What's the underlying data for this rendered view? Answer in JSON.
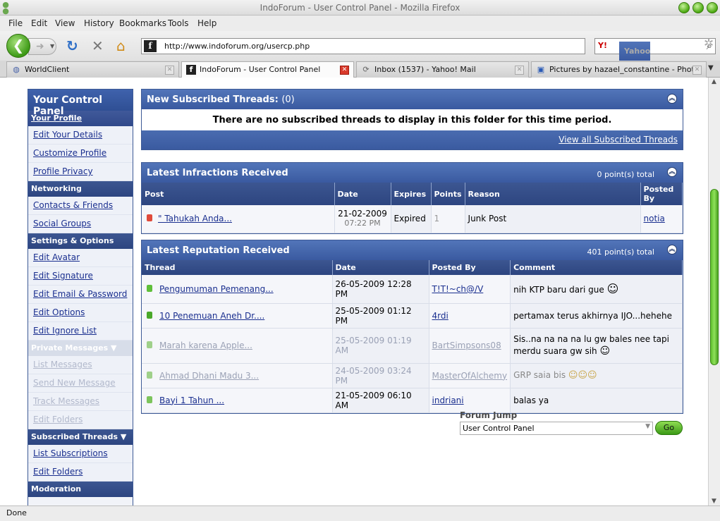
{
  "window": {
    "title": "IndoForum - User Control Panel - Mozilla Firefox"
  },
  "menu": [
    "File",
    "Edit",
    "View",
    "History",
    "Bookmarks",
    "Tools",
    "Help"
  ],
  "nav": {
    "url": "http://www.indoforum.org/usercp.php",
    "search_engine": "Y!",
    "search_placeholder": "Yahoo",
    "url_favicon": "f"
  },
  "tabs": [
    {
      "label": "WorldClient",
      "active": false
    },
    {
      "label": "IndoForum - User Control Panel",
      "active": true
    },
    {
      "label": "Inbox (1537) - Yahoo! Mail",
      "active": false
    },
    {
      "label": "Pictures by hazael_constantine - Phot...",
      "active": false
    }
  ],
  "sidebar": {
    "title": "Your Control Panel",
    "your_profile": "Your Profile",
    "profile_items": [
      "Edit Your Details",
      "Customize Profile",
      "Profile Privacy"
    ],
    "networking": "Networking",
    "networking_items": [
      "Contacts & Friends",
      "Social Groups"
    ],
    "settings": "Settings & Options",
    "settings_items": [
      "Edit Avatar",
      "Edit Signature",
      "Edit Email & Password",
      "Edit Options",
      "Edit Ignore List"
    ],
    "private_messages": "Private Messages ▼",
    "pm_items": [
      "List Messages",
      "Send New Message",
      "Track Messages",
      "Edit Folders"
    ],
    "subscribed": "Subscribed Threads ▼",
    "subscribed_items": [
      "List Subscriptions",
      "Edit Folders"
    ],
    "moderation": "Moderation"
  },
  "subscribed_panel": {
    "title": "New Subscribed Threads:",
    "count": "(0)",
    "message": "There are no subscribed threads to display in this folder for this time period.",
    "view_all": "View all Subscribed Threads"
  },
  "infractions": {
    "title": "Latest Infractions Received",
    "total": "0 point(s) total",
    "headers": [
      "Post",
      "Date",
      "Expires",
      "Points",
      "Reason",
      "Posted By"
    ],
    "row": {
      "post": "\" Tahukah Anda...",
      "date": "21-02-2009",
      "time": "07:22 PM",
      "expires": "Expired",
      "points": "1",
      "reason": "Junk Post",
      "by": "notia"
    }
  },
  "reputation": {
    "title": "Latest Reputation Received",
    "total": "401 point(s) total",
    "headers": [
      "Thread",
      "Date",
      "Posted By",
      "Comment"
    ],
    "rows": [
      {
        "thread": "Pengumuman Pemenang...",
        "date": "26-05-2009",
        "time": "12:28 PM",
        "by": "T!T!~ch@/V",
        "comment": "nih KTP baru dari gue",
        "dim": false,
        "dot": "#5fbf3a"
      },
      {
        "thread": "10 Penemuan Aneh Dr....",
        "date": "25-05-2009",
        "time": "01:12 PM",
        "by": "4rdi",
        "comment": "pertamax terus akhirnya IJO...hehehe",
        "dim": false,
        "dot": "#4aa82a"
      },
      {
        "thread": "Marah karena Apple...",
        "date": "25-05-2009",
        "time": "01:19 AM",
        "by": "BartSimpsons08",
        "comment": "Sis..na na na na lu gw bales nee tapi merdu suara gw sih",
        "dim": true,
        "dot": "#9fd08a"
      },
      {
        "thread": "Ahmad Dhani Madu 3...",
        "date": "24-05-2009",
        "time": "03:24 PM",
        "by": "MasterOfAlchemy",
        "comment": "GRP saia bis",
        "dim": true,
        "dot": "#9fd08a"
      },
      {
        "thread": "Bayi 1 Tahun ...",
        "date": "21-05-2009",
        "time": "06:10 AM",
        "by": "indriani",
        "comment": "balas ya",
        "dim": false,
        "dot": "#7cc45c"
      }
    ]
  },
  "forum_jump": {
    "label": "Forum Jump",
    "selected": "User Control Panel",
    "go": "Go"
  },
  "status": "Done"
}
